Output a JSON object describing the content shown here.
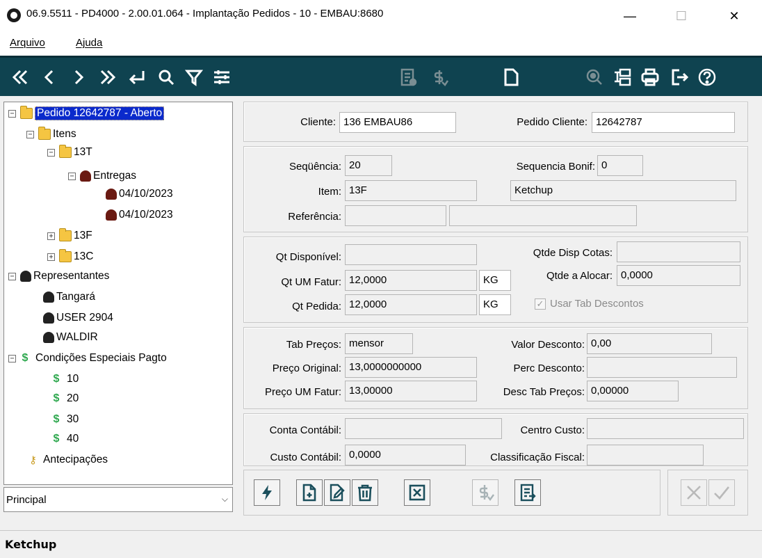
{
  "window": {
    "title": "06.9.5511 - PD4000 - 2.00.01.064 - Implantação Pedidos - 10 - EMBAU:8680",
    "minimize": "—",
    "maximize": "☐",
    "close": "✕"
  },
  "menu": {
    "file": "Arquivo",
    "help": "Ajuda"
  },
  "toolbar_icons": [
    "first-icon",
    "previous-icon",
    "next-icon",
    "last-icon",
    "return-icon",
    "search-icon",
    "filter-icon",
    "settings-icon",
    "report-icon",
    "price-icon",
    "document-icon",
    "query-icon",
    "structure-icon",
    "print-icon",
    "exit-icon",
    "help-icon"
  ],
  "tree": {
    "order": "Pedido 12642787 - Aberto",
    "items": "Itens",
    "item_13t": "13T",
    "deliveries": "Entregas",
    "delivery_1": "04/10/2023",
    "delivery_2": "04/10/2023",
    "item_13f": "13F",
    "item_13c": "13C",
    "representatives": "Representantes",
    "rep_1": "Tangará",
    "rep_2": "USER 2904",
    "rep_3": "WALDIR",
    "special_conditions": "Condições Especiais Pagto",
    "cond_1": "10",
    "cond_2": "20",
    "cond_3": "30",
    "cond_4": "40",
    "advances": "Antecipações"
  },
  "view_select": {
    "value": "Principal"
  },
  "header": {
    "client_label": "Cliente:",
    "client_value": "136 EMBAU86",
    "client_order_label": "Pedido Cliente:",
    "client_order_value": "12642787"
  },
  "item": {
    "sequence_label": "Seqüência:",
    "sequence_value": "20",
    "bonus_seq_label": "Sequencia Bonif:",
    "bonus_seq_value": "0",
    "item_label": "Item:",
    "item_value": "13F",
    "item_desc": "Ketchup",
    "reference_label": "Referência:",
    "reference_value": "",
    "reference_desc": ""
  },
  "quantities": {
    "available_label": "Qt Disponível:",
    "available_value": "",
    "quota_label": "Qtde Disp Cotas:",
    "quota_value": "",
    "um_label": "Qt UM Fatur:",
    "um_value": "12,0000",
    "um_unit": "KG",
    "allocate_label": "Qtde a Alocar:",
    "allocate_value": "0,0000",
    "ordered_label": "Qt Pedida:",
    "ordered_value": "12,0000",
    "ordered_unit": "KG",
    "use_discount_label": "Usar Tab Descontos"
  },
  "prices": {
    "table_label": "Tab Preços:",
    "table_value": "mensor",
    "discount_value_label": "Valor Desconto:",
    "discount_value": "0,00",
    "original_label": "Preço Original:",
    "original_value": "13,0000000000",
    "discount_pct_label": "Perc Desconto:",
    "discount_pct": "",
    "um_price_label": "Preço UM Fatur:",
    "um_price_value": "13,00000",
    "table_discount_label": "Desc Tab Preços:",
    "table_discount_value": "0,00000"
  },
  "accounting": {
    "account_label": "Conta Contábil:",
    "account_value": "",
    "cost_center_label": "Centro Custo:",
    "cost_center_value": "",
    "cost_label": "Custo Contábil:",
    "cost_value": "0,0000",
    "fiscal_label": "Classificação Fiscal:",
    "fiscal_value": ""
  },
  "status": {
    "text": "Ketchup"
  },
  "colors": {
    "toolbar": "#0f4350",
    "selection": "#0a2acc",
    "dollar": "#2fa84f"
  }
}
